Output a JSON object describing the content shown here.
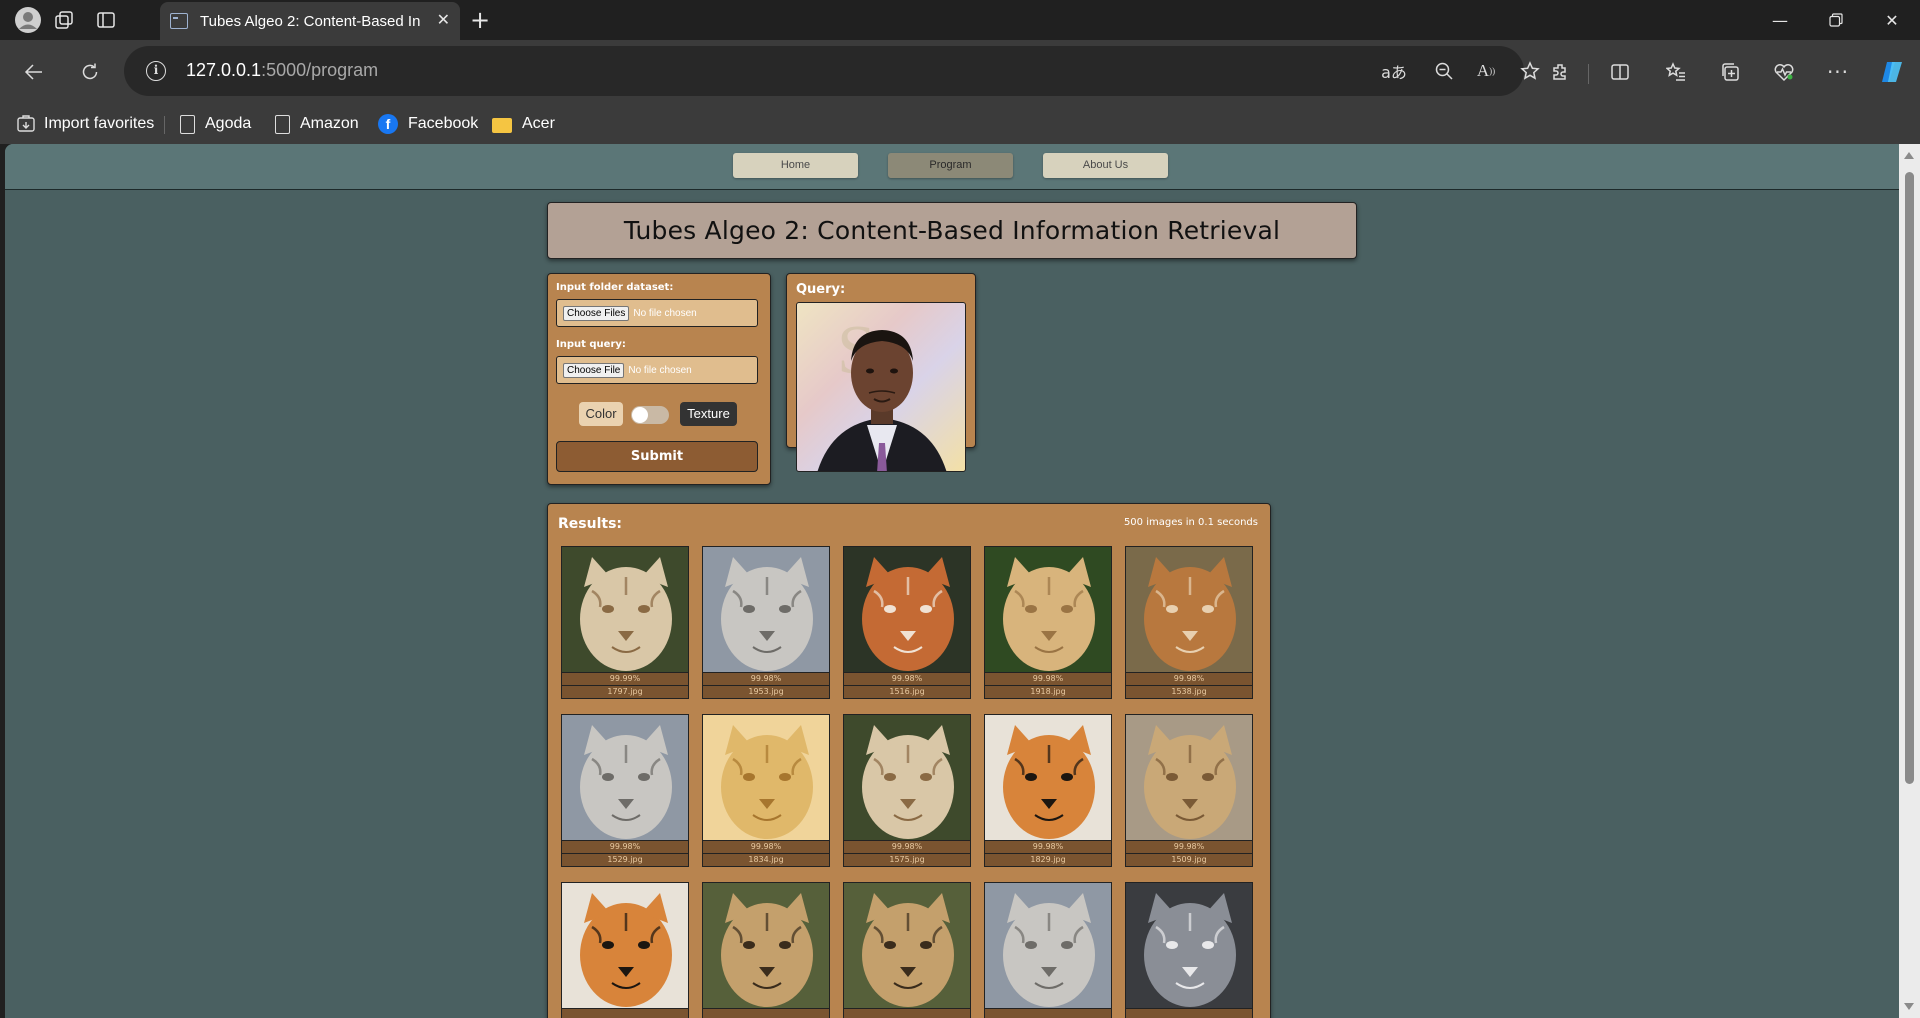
{
  "browser": {
    "tab_title": "Tubes Algeo 2: Content-Based Information Retrieval",
    "url_host": "127.0.0.1",
    "url_path": ":5000/program",
    "favorites": [
      {
        "label": "Import favorites",
        "icon": "import-icon"
      },
      {
        "label": "Agoda",
        "icon": "page-icon"
      },
      {
        "label": "Amazon",
        "icon": "page-icon"
      },
      {
        "label": "Facebook",
        "icon": "facebook-icon"
      },
      {
        "label": "Acer",
        "icon": "folder-icon"
      }
    ]
  },
  "nav": {
    "items": [
      {
        "label": "Home",
        "active": false
      },
      {
        "label": "Program",
        "active": true
      },
      {
        "label": "About Us",
        "active": false
      }
    ]
  },
  "page": {
    "title": "Tubes Algeo 2: Content-Based Information Retrieval"
  },
  "input_panel": {
    "dataset_label": "Input folder dataset:",
    "dataset_button": "Choose Files",
    "dataset_status": "No file chosen",
    "query_label": "Input query:",
    "query_button": "Choose File",
    "query_status": "No file chosen",
    "toggle_left": "Color",
    "toggle_right": "Texture",
    "submit_label": "Submit"
  },
  "query_panel": {
    "label": "Query:"
  },
  "results": {
    "label": "Results:",
    "stat": "500 images in 0.1 seconds",
    "items": [
      {
        "score": "99.99%",
        "file": "1797.jpg",
        "animal": "cheetah-cub"
      },
      {
        "score": "99.98%",
        "file": "1953.jpg",
        "animal": "snow-leopard"
      },
      {
        "score": "99.98%",
        "file": "1516.jpg",
        "animal": "fox"
      },
      {
        "score": "99.98%",
        "file": "1918.jpg",
        "animal": "lioness"
      },
      {
        "score": "99.98%",
        "file": "1538.jpg",
        "animal": "jackal"
      },
      {
        "score": "99.98%",
        "file": "1529.jpg",
        "animal": "snow-leopard"
      },
      {
        "score": "99.98%",
        "file": "1834.jpg",
        "animal": "lion"
      },
      {
        "score": "99.98%",
        "file": "1575.jpg",
        "animal": "cheetah-cub"
      },
      {
        "score": "99.98%",
        "file": "1829.jpg",
        "animal": "tiger"
      },
      {
        "score": "99.98%",
        "file": "1509.jpg",
        "animal": "cheetah"
      },
      {
        "score": "",
        "file": "",
        "animal": "tiger"
      },
      {
        "score": "",
        "file": "",
        "animal": "leopard"
      },
      {
        "score": "",
        "file": "",
        "animal": "leopard"
      },
      {
        "score": "",
        "file": "",
        "animal": "snow-leopard"
      },
      {
        "score": "",
        "file": "",
        "animal": "wolf"
      }
    ]
  },
  "colors": {
    "page_bg": "#4a6061",
    "nav_bg": "#5b7677",
    "panel_bg": "#b8844f",
    "title_bg": "#b3a195",
    "submit_bg": "#8d5c33"
  }
}
